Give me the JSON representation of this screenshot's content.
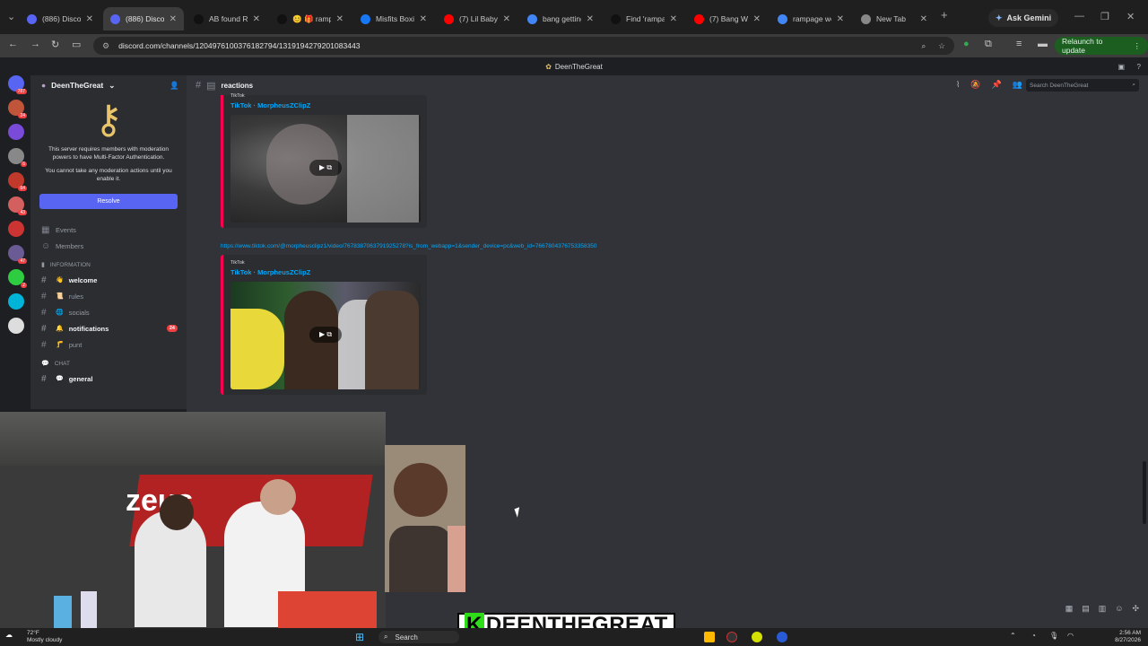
{
  "browser": {
    "tabs": [
      {
        "title": "(886) Discord",
        "color": "#5865f2"
      },
      {
        "title": "(886) Discord",
        "color": "#5865f2",
        "active": true
      },
      {
        "title": "AB found Ra",
        "color": "#111111"
      },
      {
        "title": "😊 🎁 rampa",
        "color": "#111111"
      },
      {
        "title": "Misfits Boxin",
        "color": "#1877f2"
      },
      {
        "title": "(7) Lil Baby &",
        "color": "#ff0000"
      },
      {
        "title": "bang getting",
        "color": "#4285f4"
      },
      {
        "title": "Find 'rampa",
        "color": "#111111"
      },
      {
        "title": "(7) Bang Wi",
        "color": "#ff0000"
      },
      {
        "title": "rampage we",
        "color": "#4285f4"
      },
      {
        "title": "New Tab",
        "color": "#888888"
      }
    ],
    "new_tab_icon": "+",
    "ask_gemini": "Ask Gemini",
    "url": "discord.com/channels/1204976100376182794/1319194279201083443",
    "relaunch": "Relaunch to update"
  },
  "discord": {
    "window_title": "DeenTheGreat",
    "server_name": "DeenTheGreat",
    "mfa_text_1": "This server requires members with moderation powers to have Multi-Factor Authentication.",
    "mfa_text_2": "You cannot take any moderation actions until you enable it.",
    "resolve": "Resolve",
    "events": "Events",
    "members": "Members",
    "category_info": "INFORMATION",
    "channels": [
      {
        "name": "welcome",
        "emoji": "👋",
        "bold": true
      },
      {
        "name": "rules",
        "emoji": "📜"
      },
      {
        "name": "socials",
        "emoji": "🌐"
      },
      {
        "name": "notifications",
        "emoji": "🔔",
        "bold": true,
        "count": "24"
      },
      {
        "name": "punt",
        "emoji": "🦵"
      }
    ],
    "category_chat": "CHAT",
    "chat_channel": "general",
    "current_channel": "reactions",
    "search_placeholder": "Search DeenTheGreat",
    "embed1": {
      "provider": "TikTok",
      "title": "TikTok · MorpheusZClipZ"
    },
    "link": "https://www.tiktok.com/@morpheusclipz1/video/7678387063791925278?is_from_webapp=1&sender_device=pc&web_id=7667804376753358350",
    "embed2": {
      "provider": "TikTok",
      "title": "TikTok · MorpheusZClipZ"
    },
    "server_badges": [
      "787",
      "24",
      "",
      "6",
      "64",
      "43",
      "",
      "47",
      "2",
      "",
      ""
    ]
  },
  "overlay": {
    "streamer_k": "K",
    "streamer_name": "DEENTHEGREAT"
  },
  "taskbar": {
    "temp": "72°F",
    "weather": "Mostly cloudy",
    "search": "Search",
    "time": "2:56 AM",
    "date": "8/27/2026"
  }
}
